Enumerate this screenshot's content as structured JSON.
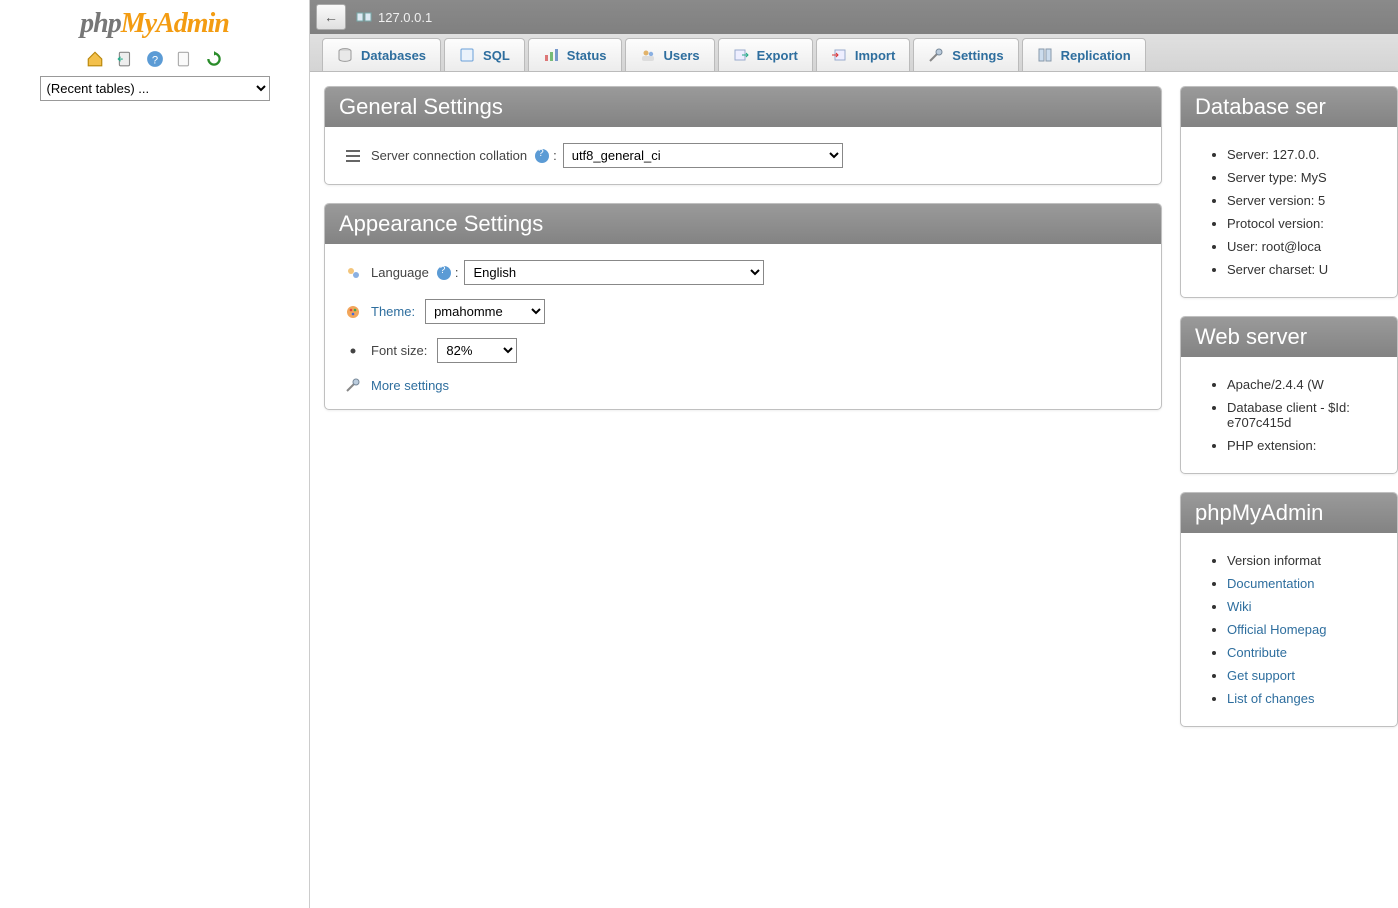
{
  "logo": {
    "part1": "php",
    "part2": "MyAdmin"
  },
  "sidebar": {
    "recent_placeholder": "(Recent tables) ..."
  },
  "breadcrumb": {
    "host": "127.0.0.1"
  },
  "tabs": [
    {
      "label": "Databases"
    },
    {
      "label": "SQL"
    },
    {
      "label": "Status"
    },
    {
      "label": "Users"
    },
    {
      "label": "Export"
    },
    {
      "label": "Import"
    },
    {
      "label": "Settings"
    },
    {
      "label": "Replication"
    }
  ],
  "general": {
    "title": "General Settings",
    "collation_label": "Server connection collation",
    "collation_value": "utf8_general_ci"
  },
  "appearance": {
    "title": "Appearance Settings",
    "language_label": "Language",
    "language_value": "English",
    "theme_label": "Theme:",
    "theme_value": "pmahomme",
    "fontsize_label": "Font size:",
    "fontsize_value": "82%",
    "more_settings": "More settings"
  },
  "dbserver": {
    "title": "Database ser",
    "items": [
      "Server: 127.0.0.",
      "Server type: MyS",
      "Server version: 5",
      "Protocol version:",
      "User: root@loca",
      "Server charset: U"
    ]
  },
  "webserver": {
    "title": "Web server",
    "items": [
      "Apache/2.4.4 (W",
      "Database client - $Id: e707c415d",
      "PHP extension:"
    ]
  },
  "pma": {
    "title": "phpMyAdmin",
    "items": [
      {
        "text": "Version informat",
        "link": false
      },
      {
        "text": "Documentation",
        "link": true
      },
      {
        "text": "Wiki",
        "link": true
      },
      {
        "text": "Official Homepag",
        "link": true
      },
      {
        "text": "Contribute",
        "link": true
      },
      {
        "text": "Get support",
        "link": true
      },
      {
        "text": "List of changes",
        "link": true
      }
    ]
  }
}
